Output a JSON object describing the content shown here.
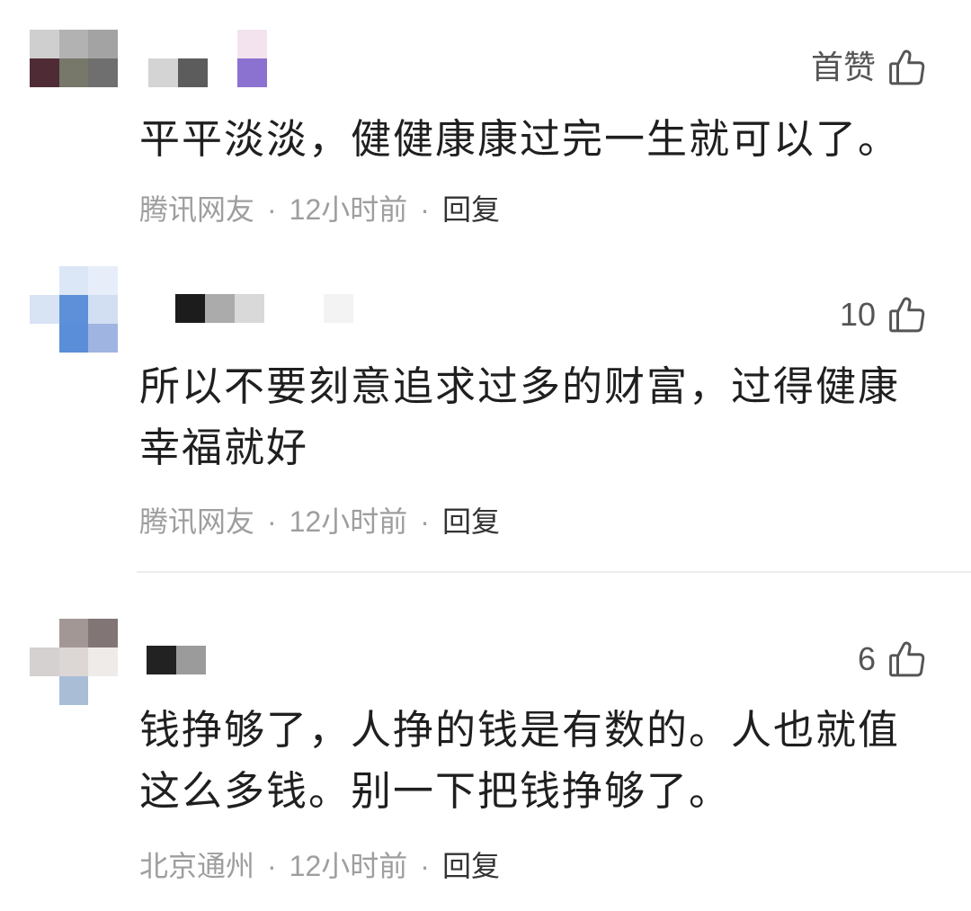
{
  "icons": {
    "like": "thumbs-up-icon"
  },
  "meta_separator": "·",
  "colors": {
    "text": "#1f1f1f",
    "meta": "#9e9e9e",
    "reply": "#333333",
    "like": "#555555",
    "divider": "#ededed"
  },
  "comments": [
    {
      "avatar_mosaic": [
        [
          "#cfcfcf",
          "#b2b2b2",
          "#a3a3a3"
        ],
        [
          "#4f2b35",
          "#77776a",
          "#6f6f6f"
        ]
      ],
      "username_mosaic": [
        [
          null,
          null,
          null,
          "#f2e3ee"
        ],
        [
          "#d4d4d4",
          "#5c5c5c",
          null,
          "#8c72d0"
        ]
      ],
      "like_text": "首赞",
      "text": "平平淡淡，健健康康过完一生就可以了。",
      "location": "腾讯网友",
      "time": "12小时前",
      "reply_label": "回复"
    },
    {
      "avatar_mosaic": [
        [
          null,
          "#dbe7f6",
          "#e7eef9"
        ],
        [
          "#d8e4f4",
          "#5d90d8",
          "#d2dff3"
        ],
        [
          null,
          "#5b8ed8",
          "#a0b4e2"
        ]
      ],
      "username_mosaic": [
        [
          "#1c1c1c",
          "#ababab",
          "#d9d9d9",
          null,
          null,
          "#f3f3f3"
        ]
      ],
      "like_text": "10",
      "text": "所以不要刻意追求过多的财富，过得健康幸福就好",
      "location": "腾讯网友",
      "time": "12小时前",
      "reply_label": "回复"
    },
    {
      "avatar_mosaic": [
        [
          null,
          "#a39796",
          "#817576"
        ],
        [
          "#d5d1d1",
          "#dcd6d4",
          "#efebe9"
        ],
        [
          null,
          "#a9bdd6",
          null
        ]
      ],
      "username_mosaic": [
        [
          "#222222",
          "#9b9b9b"
        ]
      ],
      "like_text": "6",
      "text": "钱挣够了，人挣的钱是有数的。人也就值这么多钱。别一下把钱挣够了。",
      "location": "北京通州",
      "time": "12小时前",
      "reply_label": "回复"
    }
  ]
}
